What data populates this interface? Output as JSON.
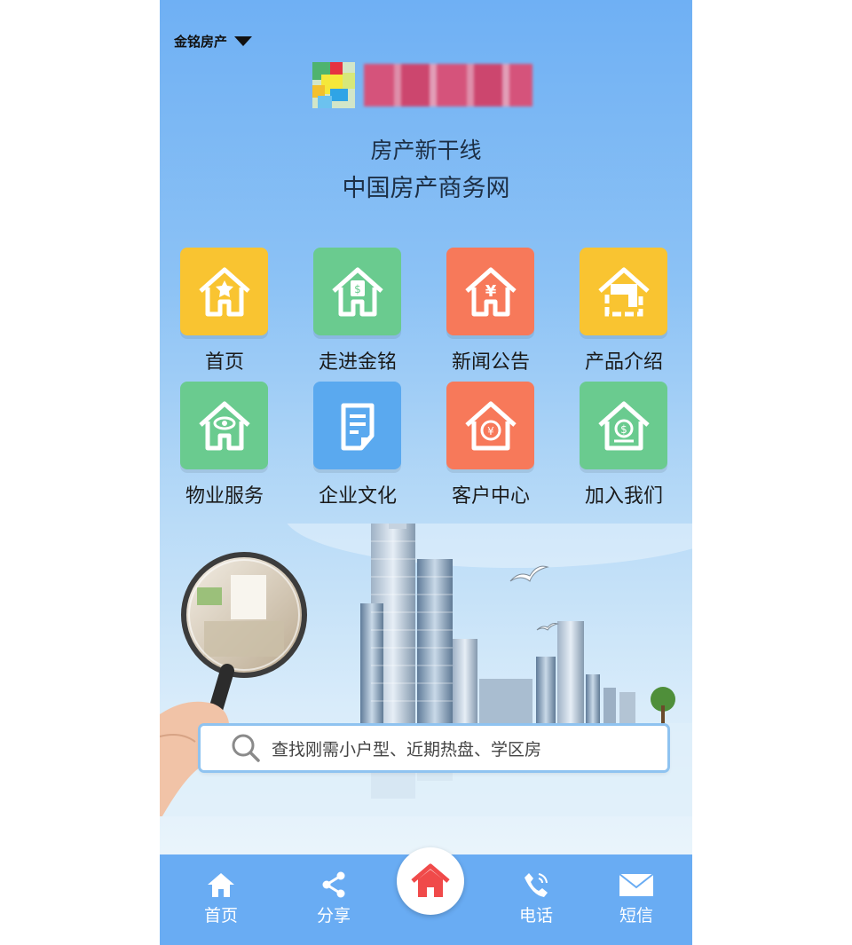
{
  "header": {
    "city": "金铭房产",
    "tagline_line1": "房产新干线",
    "tagline_line2": "中国房产商务网"
  },
  "menu": [
    {
      "label": "首页",
      "icon": "home-star-icon",
      "color": "#f9c431"
    },
    {
      "label": "走进金铭",
      "icon": "home-dollar-icon",
      "color": "#6acb8f"
    },
    {
      "label": "新闻公告",
      "icon": "home-yen-icon",
      "color": "#f7795a"
    },
    {
      "label": "产品介绍",
      "icon": "home-card-icon",
      "color": "#f9c431"
    },
    {
      "label": "物业服务",
      "icon": "home-eye-icon",
      "color": "#6acb8f"
    },
    {
      "label": "企业文化",
      "icon": "document-icon",
      "color": "#5aa9ef"
    },
    {
      "label": "客户中心",
      "icon": "home-coin-icon",
      "color": "#f7795a"
    },
    {
      "label": "加入我们",
      "icon": "home-money-icon",
      "color": "#6acb8f"
    }
  ],
  "search": {
    "placeholder": "查找刚需小户型、近期热盘、学区房"
  },
  "tabbar": {
    "home": "首页",
    "share": "分享",
    "phone": "电话",
    "sms": "短信"
  },
  "colors": {
    "tab_bar": "#69acf3",
    "home_button_icon": "#f04a4a"
  }
}
